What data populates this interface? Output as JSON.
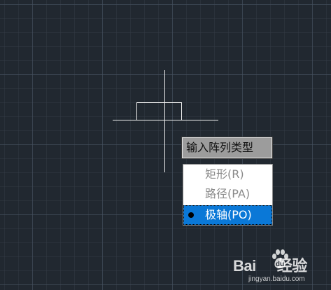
{
  "prompt": {
    "text": "输入阵列类型"
  },
  "menu": {
    "items": [
      {
        "label": "矩形(R)",
        "selected": false
      },
      {
        "label": "路径(PA)",
        "selected": false
      },
      {
        "label": "极轴(PO)",
        "selected": true
      }
    ]
  },
  "watermark": {
    "logo": "Bai",
    "logo_suffix": "经验",
    "url": "jingyan.baidu.com"
  },
  "colors": {
    "canvas_bg": "#212830",
    "menu_highlight": "#0a78d7",
    "prompt_bg": "#9c9c9c"
  }
}
